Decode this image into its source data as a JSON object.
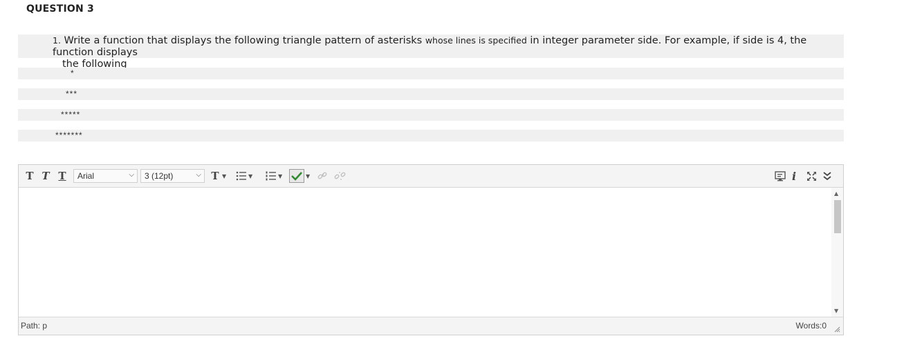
{
  "question": {
    "title": "QUESTION 3",
    "number": "1.",
    "text_a": "Write a function that displays the following triangle pattern of asterisks",
    "text_small": "whose lines is specified",
    "text_b": "in integer parameter side. For example, if side is 4, the function displays",
    "text_c": "the following",
    "pattern": [
      "*",
      "***",
      "*****",
      "*******"
    ]
  },
  "toolbar": {
    "font_family": "Arial",
    "font_size": "3 (12pt)"
  },
  "status": {
    "path": "Path: p",
    "words": "Words:0"
  },
  "icons": [
    "text-bold-icon",
    "text-italic-icon",
    "text-underline-icon",
    "text-color-icon",
    "bullet-list-icon",
    "numbered-list-icon",
    "spellcheck-icon",
    "link-icon",
    "unlink-icon",
    "preview-icon",
    "info-icon",
    "fullscreen-icon",
    "collapse-toolbar-icon"
  ]
}
